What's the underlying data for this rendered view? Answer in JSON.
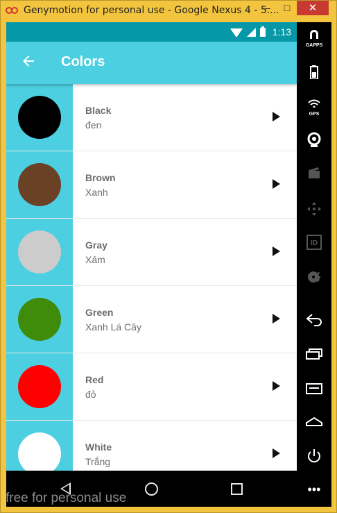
{
  "window": {
    "title": "Genymotion for personal use - Google Nexus 4 - 5....",
    "minimize": "–",
    "maximize": "□",
    "close": "✕"
  },
  "statusbar": {
    "time": "1:13"
  },
  "appbar": {
    "title": "Colors",
    "back_icon": "arrow-back-icon"
  },
  "colors": [
    {
      "name": "Black",
      "translation": "đen",
      "swatch": "#000000"
    },
    {
      "name": "Brown",
      "translation": "Xanh",
      "swatch": "#6b4126"
    },
    {
      "name": "Gray",
      "translation": "Xám",
      "swatch": "#cccccc"
    },
    {
      "name": "Green",
      "translation": "Xanh Lá Cây",
      "swatch": "#3f8b0a"
    },
    {
      "name": "Red",
      "translation": "đỏ",
      "swatch": "#ff0000"
    },
    {
      "name": "White",
      "translation": "Trắng",
      "swatch": "#ffffff"
    }
  ],
  "sidebar": {
    "gapps_label": "GAPPS",
    "gps_label": "GPS",
    "id_label": "ID",
    "more": "•••"
  },
  "watermark": "free for personal use"
}
